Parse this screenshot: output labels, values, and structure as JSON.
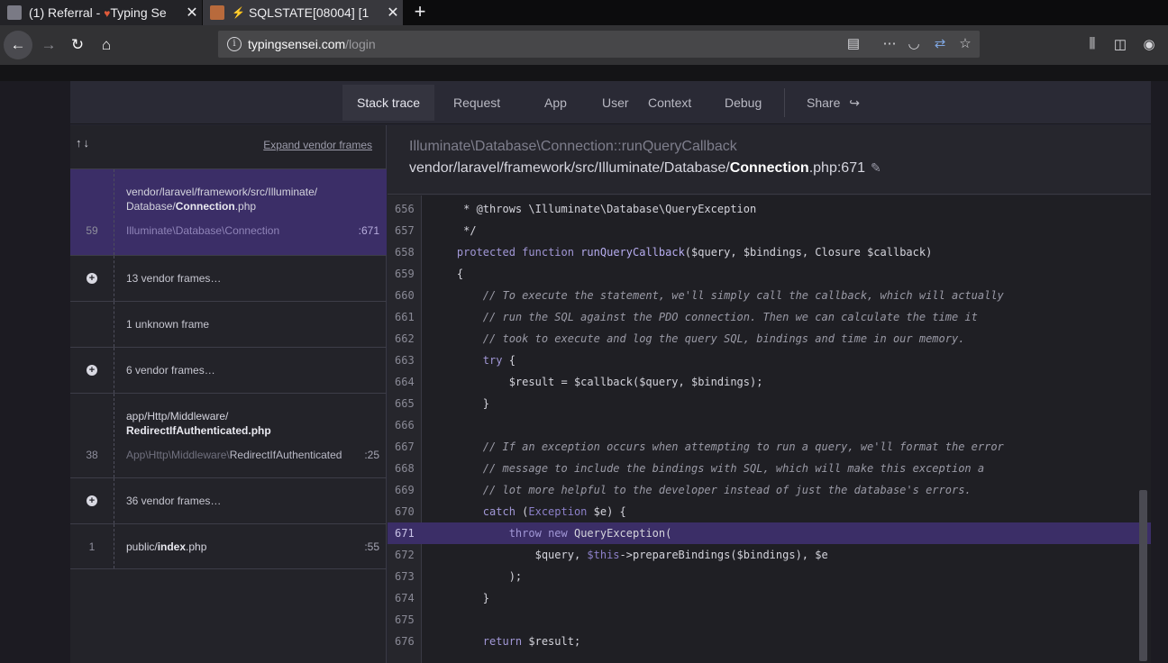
{
  "browser": {
    "tabs": [
      {
        "title": "(1) Referral - ",
        "title2": "Typing Se",
        "active": false
      },
      {
        "title": "SQLSTATE[08004] [1",
        "active": true
      }
    ],
    "url_domain": "typingsensei.com",
    "url_path": "/login"
  },
  "nav": {
    "tabs": [
      "Stack trace",
      "Request",
      "App",
      "User",
      "Context",
      "Debug"
    ],
    "share": "Share"
  },
  "sidebar": {
    "expand_label": "Expand vendor frames",
    "frames": [
      {
        "num": "59",
        "file_prefix": "vendor/laravel/framework/src/Illuminate/",
        "file_dir": "Database/",
        "file_name": "Connection",
        "file_ext": ".php",
        "class_ns": "Illuminate\\Database\\",
        "class_name": "Connection",
        "line": ":671"
      },
      {
        "text": "13 vendor frames…"
      },
      {
        "text": "1 unknown frame"
      },
      {
        "text": "6 vendor frames…"
      },
      {
        "num": "38",
        "file_prefix": "app/Http/Middleware/",
        "file_name": "RedirectIfAuthenticated",
        "file_ext": ".php",
        "class_ns": "App\\Http\\Middleware\\",
        "class_name": "RedirectIfAuthenticated",
        "line": ":25"
      },
      {
        "text": "36 vendor frames…"
      },
      {
        "num": "1",
        "file_prefix": "public/",
        "file_name": "index",
        "file_ext": ".php",
        "line": ":55"
      }
    ]
  },
  "main": {
    "method": "Illuminate\\Database\\Connection::runQueryCallback",
    "path_prefix": "vendor/laravel/framework/src/Illuminate/Database/",
    "path_file": "Connection",
    "path_suffix": ".php:671"
  },
  "code": {
    "highlight_line": 671,
    "lines": [
      {
        "n": "656",
        "t": "     * @throws \\Illuminate\\Database\\QueryException"
      },
      {
        "n": "657",
        "t": "     */"
      },
      {
        "n": "658",
        "t": "    protected function runQueryCallback($query, $bindings, Closure $callback)"
      },
      {
        "n": "659",
        "t": "    {"
      },
      {
        "n": "660",
        "t": "        // To execute the statement, we'll simply call the callback, which will actually"
      },
      {
        "n": "661",
        "t": "        // run the SQL against the PDO connection. Then we can calculate the time it"
      },
      {
        "n": "662",
        "t": "        // took to execute and log the query SQL, bindings and time in our memory."
      },
      {
        "n": "663",
        "t": "        try {"
      },
      {
        "n": "664",
        "t": "            $result = $callback($query, $bindings);"
      },
      {
        "n": "665",
        "t": "        }"
      },
      {
        "n": "666",
        "t": ""
      },
      {
        "n": "667",
        "t": "        // If an exception occurs when attempting to run a query, we'll format the error"
      },
      {
        "n": "668",
        "t": "        // message to include the bindings with SQL, which will make this exception a"
      },
      {
        "n": "669",
        "t": "        // lot more helpful to the developer instead of just the database's errors."
      },
      {
        "n": "670",
        "t": "        catch (Exception $e) {"
      },
      {
        "n": "671",
        "t": "            throw new QueryException("
      },
      {
        "n": "672",
        "t": "                $query, $this->prepareBindings($bindings), $e"
      },
      {
        "n": "673",
        "t": "            );"
      },
      {
        "n": "674",
        "t": "        }"
      },
      {
        "n": "675",
        "t": ""
      },
      {
        "n": "676",
        "t": "        return $result;"
      }
    ]
  }
}
